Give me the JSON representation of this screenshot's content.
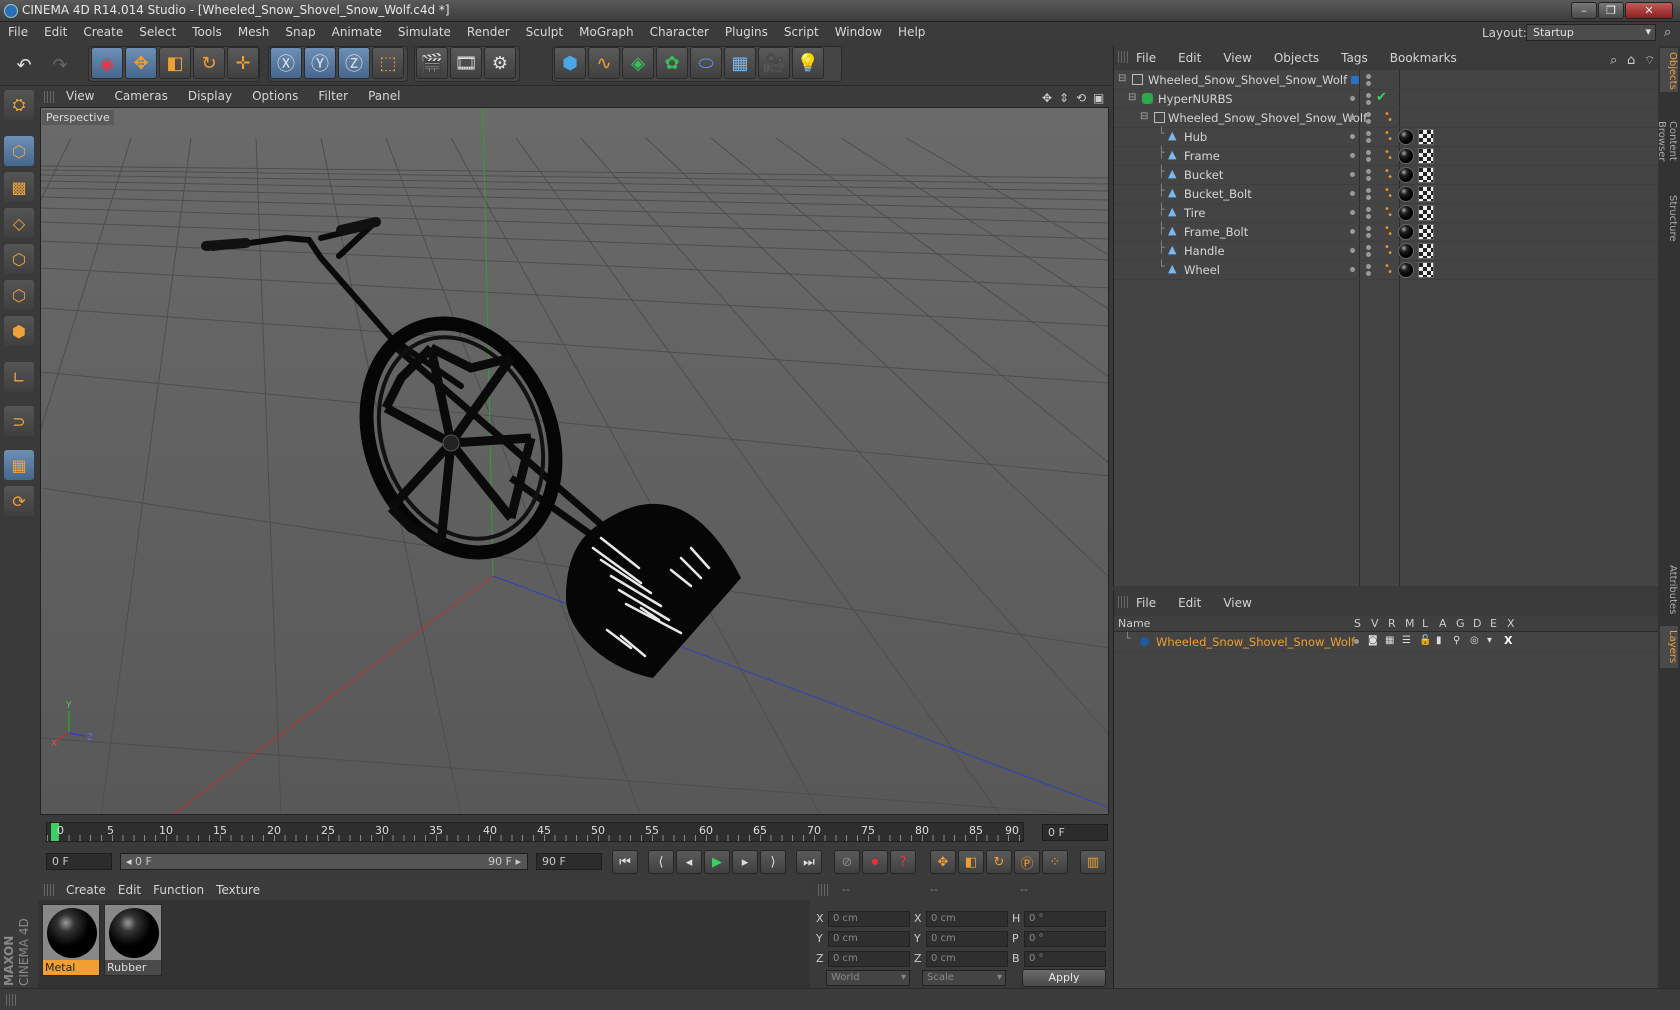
{
  "window": {
    "title": "CINEMA 4D R14.014 Studio - [Wheeled_Snow_Shovel_Snow_Wolf.c4d *]"
  },
  "menubar": [
    "File",
    "Edit",
    "Create",
    "Select",
    "Tools",
    "Mesh",
    "Snap",
    "Animate",
    "Simulate",
    "Render",
    "Sculpt",
    "MoGraph",
    "Character",
    "Plugins",
    "Script",
    "Window",
    "Help"
  ],
  "layout": {
    "label": "Layout:",
    "value": "Startup"
  },
  "viewport": {
    "menu": [
      "View",
      "Cameras",
      "Display",
      "Options",
      "Filter",
      "Panel"
    ],
    "label": "Perspective",
    "axis": {
      "y": "Y",
      "x": "X",
      "z": "Z"
    }
  },
  "timeline": {
    "ticks": [
      "0",
      "5",
      "10",
      "15",
      "20",
      "25",
      "30",
      "35",
      "40",
      "45",
      "50",
      "55",
      "60",
      "65",
      "70",
      "75",
      "80",
      "85",
      "90"
    ],
    "current_frame": "0 F"
  },
  "transport": {
    "start": "0 F",
    "range_start": "0 F",
    "range_end": "90 F",
    "end": "90 F"
  },
  "materials": {
    "menu": [
      "Create",
      "Edit",
      "Function",
      "Texture"
    ],
    "items": [
      {
        "name": "Metal",
        "selected": true
      },
      {
        "name": "Rubber",
        "selected": false
      }
    ]
  },
  "coordinates": {
    "headers": [
      "--",
      "--",
      "--"
    ],
    "rows": [
      {
        "a": "X",
        "av": "0 cm",
        "b": "X",
        "bv": "0 cm",
        "c": "H",
        "cv": "0 °"
      },
      {
        "a": "Y",
        "av": "0 cm",
        "b": "Y",
        "bv": "0 cm",
        "c": "P",
        "cv": "0 °"
      },
      {
        "a": "Z",
        "av": "0 cm",
        "b": "Z",
        "bv": "0 cm",
        "c": "B",
        "cv": "0 °"
      }
    ],
    "mode": "World",
    "size_mode": "Scale",
    "apply": "Apply"
  },
  "objects": {
    "menu": [
      "File",
      "Edit",
      "View",
      "Objects",
      "Tags",
      "Bookmarks"
    ],
    "tree": [
      {
        "name": "Wheeled_Snow_Shovel_Snow_Wolf",
        "type": "null",
        "level": 0,
        "tags": false
      },
      {
        "name": "HyperNURBS",
        "type": "nurbs",
        "level": 1,
        "tags": false
      },
      {
        "name": "Wheeled_Snow_Shovel_Snow_Wolf",
        "type": "null",
        "level": 2,
        "tags": false
      },
      {
        "name": "Hub",
        "type": "poly",
        "level": 3,
        "tags": true
      },
      {
        "name": "Frame",
        "type": "poly",
        "level": 3,
        "tags": true
      },
      {
        "name": "Bucket",
        "type": "poly",
        "level": 3,
        "tags": true
      },
      {
        "name": "Bucket_Bolt",
        "type": "poly",
        "level": 3,
        "tags": true
      },
      {
        "name": "Tire",
        "type": "poly",
        "level": 3,
        "tags": true
      },
      {
        "name": "Frame_Bolt",
        "type": "poly",
        "level": 3,
        "tags": true
      },
      {
        "name": "Handle",
        "type": "poly",
        "level": 3,
        "tags": true
      },
      {
        "name": "Wheel",
        "type": "poly",
        "level": 3,
        "tags": true
      }
    ]
  },
  "layers": {
    "menu": [
      "File",
      "Edit",
      "View"
    ],
    "columns": [
      "Name",
      "S",
      "V",
      "R",
      "M",
      "L",
      "A",
      "G",
      "D",
      "E",
      "X"
    ],
    "items": [
      {
        "name": "Wheeled_Snow_Shovel_Snow_Wolf",
        "color": "#1e5aa0"
      }
    ]
  },
  "side_tabs": [
    "Objects",
    "Content Browser",
    "Structure",
    "Attributes",
    "Layers"
  ],
  "brand": {
    "line1": "MAXON",
    "line2": "CINEMA 4D"
  },
  "colors": {
    "accent_orange": "#f0a030",
    "grid_bg": "#5e5e5e",
    "x_axis": "#c03030",
    "y_axis": "#30a030",
    "z_axis": "#3040c0"
  }
}
